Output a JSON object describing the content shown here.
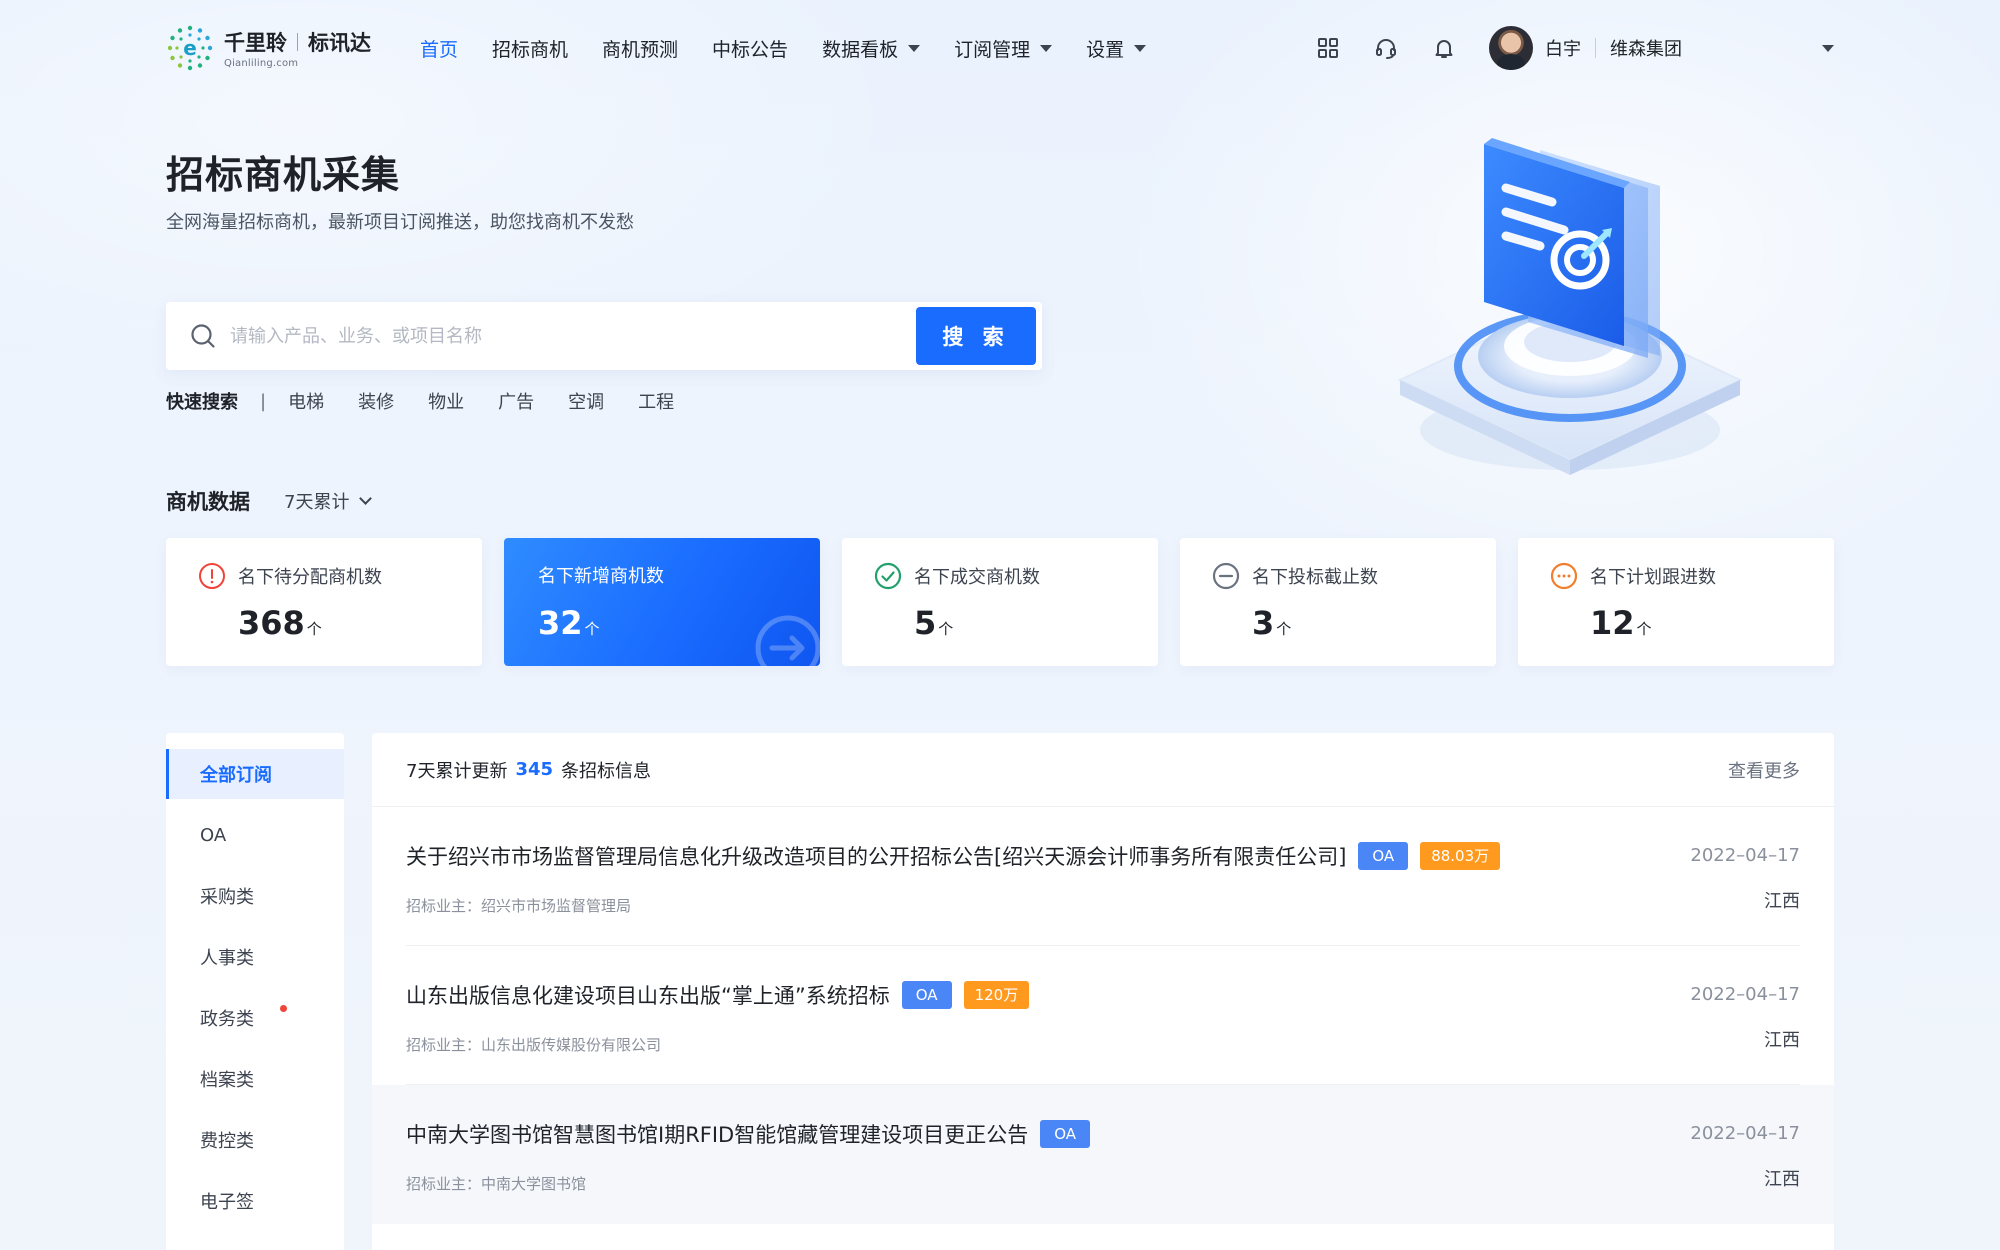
{
  "brand": {
    "name": "千里聆",
    "product": "标讯达",
    "domain": "Qianliling.com",
    "accent": "#1a6cff"
  },
  "nav": {
    "items": [
      {
        "label": "首页"
      },
      {
        "label": "招标商机"
      },
      {
        "label": "商机预测"
      },
      {
        "label": "中标公告"
      },
      {
        "label": "数据看板"
      },
      {
        "label": "订阅管理"
      },
      {
        "label": "设置"
      }
    ]
  },
  "header": {
    "icons": [
      "apps-grid-icon",
      "headset-icon",
      "bell-icon"
    ],
    "user_name": "白宇",
    "company": "维森集团"
  },
  "hero": {
    "title": "招标商机采集",
    "subtitle": "全网海量招标商机，最新项目订阅推送，助您找商机不发愁"
  },
  "search": {
    "placeholder": "请输入产品、业务、或项目名称",
    "button": "搜 索"
  },
  "quick_search": {
    "label": "快速搜索",
    "separator": "|",
    "items": [
      "电梯",
      "装修",
      "物业",
      "广告",
      "空调",
      "工程"
    ]
  },
  "stats": {
    "title": "商机数据",
    "range": "7天累计",
    "cards": [
      {
        "label": "名下待分配商机数",
        "value": "368",
        "unit": "个",
        "icon": "info-circle-icon",
        "color": "#f04438"
      },
      {
        "label": "名下新增商机数",
        "value": "32",
        "unit": "个",
        "icon": "arrow-right-circle-icon",
        "color": "#1a6cff"
      },
      {
        "label": "名下成交商机数",
        "value": "5",
        "unit": "个",
        "icon": "check-circle-icon",
        "color": "#22a06b"
      },
      {
        "label": "名下投标截止数",
        "value": "3",
        "unit": "个",
        "icon": "minus-circle-icon",
        "color": "#6b7280"
      },
      {
        "label": "名下计划跟进数",
        "value": "12",
        "unit": "个",
        "icon": "more-circle-icon",
        "color": "#f27d2a"
      }
    ]
  },
  "sidebar": {
    "items": [
      {
        "label": "全部订阅"
      },
      {
        "label": "OA"
      },
      {
        "label": "采购类"
      },
      {
        "label": "人事类"
      },
      {
        "label": "政务类"
      },
      {
        "label": "档案类"
      },
      {
        "label": "费控类"
      },
      {
        "label": "电子签"
      }
    ]
  },
  "list": {
    "summary_prefix": "7天累计更新",
    "summary_count": "345",
    "summary_suffix": "条招标信息",
    "more": "查看更多",
    "rows": [
      {
        "title": "关于绍兴市市场监督管理局信息化升级改造项目的公开招标公告[绍兴天源会计师事务所有限责任公司]",
        "tag": "OA",
        "amount": "88.03万",
        "owner": "招标业主：绍兴市市场监督管理局",
        "date": "2022–04–17",
        "region": "江西"
      },
      {
        "title": "山东出版信息化建设项目山东出版“掌上通”系统招标",
        "tag": "OA",
        "amount": "120万",
        "owner": "招标业主：山东出版传媒股份有限公司",
        "date": "2022–04–17",
        "region": "江西"
      },
      {
        "title": "中南大学图书馆智慧图书馆I期RFID智能馆藏管理建设项目更正公告",
        "tag": "OA",
        "amount": "",
        "owner": "招标业主：中南大学图书馆",
        "date": "2022–04–17",
        "region": "江西"
      }
    ]
  }
}
